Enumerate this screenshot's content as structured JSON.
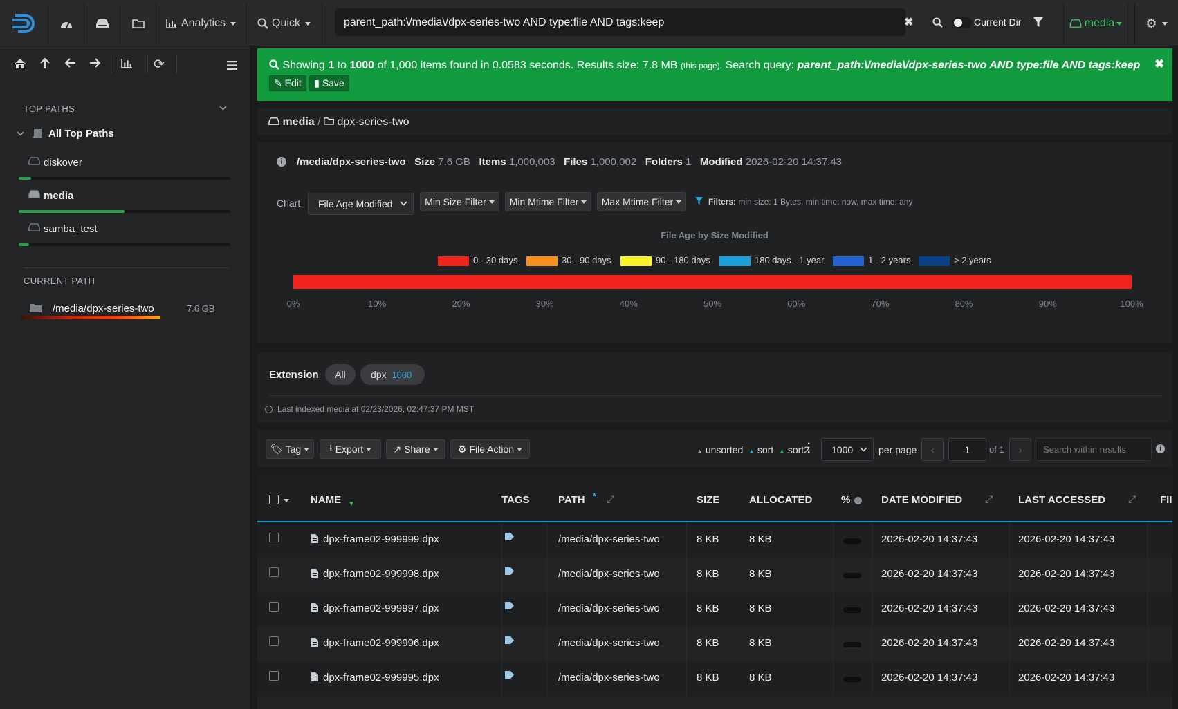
{
  "topbar": {
    "analytics": "Analytics",
    "quick": "Quick",
    "search_value": "parent_path:\\/media\\/dpx-series-two AND type:file AND tags:keep",
    "current_dir": "Current Dir",
    "index": "media"
  },
  "sidebar": {
    "top_paths_header": "TOP PATHS",
    "all_top_paths": "All Top Paths",
    "paths": [
      {
        "name": "diskover",
        "usage": 0.06
      },
      {
        "name": "media",
        "usage": 0.5
      },
      {
        "name": "samba_test",
        "usage": 0.05
      }
    ],
    "current_path_header": "CURRENT PATH",
    "current_path": "/media/dpx-series-two",
    "current_size": "7.6 GB"
  },
  "alert": {
    "showing": "Showing",
    "from": "1",
    "to_word": "to",
    "to": "1000",
    "of_text": "of 1,000 items found in 0.0583 seconds. Results size: 7.8 MB",
    "this_page": "(this page).",
    "query_label": "Search query:",
    "query": "parent_path:\\/media\\/dpx-series-two AND type:file AND tags:keep",
    "edit": "Edit",
    "save": "Save"
  },
  "breadcrumb": {
    "root": "media",
    "sep": "/",
    "folder": "dpx-series-two"
  },
  "info": {
    "path": "/media/dpx-series-two",
    "size_label": "Size",
    "size": "7.6 GB",
    "items_label": "Items",
    "items": "1,000,003",
    "files_label": "Files",
    "files": "1,000,002",
    "folders_label": "Folders",
    "folders": "1",
    "modified_label": "Modified",
    "modified": "2026-02-20 14:37:43"
  },
  "chart_controls": {
    "chart_label": "Chart",
    "chart_select": "File Age Modified",
    "min_size": "Min Size Filter",
    "min_mtime": "Min Mtime Filter",
    "max_mtime": "Max Mtime Filter",
    "filters_label": "Filters:",
    "filters_text": "min size: 1 Bytes, min time: now, max time: any"
  },
  "chart_data": {
    "type": "bar",
    "title": "File Age by Size Modified",
    "orientation": "horizontal-stacked",
    "series": [
      {
        "name": "0 - 30 days",
        "value": 100,
        "color": "#f0241b"
      },
      {
        "name": "30 - 90 days",
        "value": 0,
        "color": "#f7901e"
      },
      {
        "name": "90 - 180 days",
        "value": 0,
        "color": "#f8f328"
      },
      {
        "name": "180 days - 1 year",
        "value": 0,
        "color": "#1a9fd9"
      },
      {
        "name": "1 - 2 years",
        "value": 0,
        "color": "#2262d1"
      },
      {
        "name": "> 2 years",
        "value": 0,
        "color": "#0b4184"
      }
    ],
    "xlim": [
      0,
      100
    ],
    "ticks": [
      "0%",
      "10%",
      "20%",
      "30%",
      "40%",
      "50%",
      "60%",
      "70%",
      "80%",
      "90%",
      "100%"
    ]
  },
  "extension": {
    "label": "Extension",
    "all": "All",
    "ext": "dpx",
    "count": "1000"
  },
  "last_indexed": "Last indexed media at 02/23/2026, 02:47:37 PM MST",
  "toolbar": {
    "tag": "Tag",
    "export": "Export",
    "share": "Share",
    "file_action": "File Action",
    "unsorted": "unsorted",
    "sort": "sort",
    "sort2": "sort2",
    "per_page_value": "1000",
    "per_page": "per page",
    "page": "1",
    "of": "of 1",
    "search_placeholder": "Search within results"
  },
  "table": {
    "headers": {
      "name": "NAME",
      "tags": "TAGS",
      "path": "PATH",
      "size": "SIZE",
      "allocated": "ALLOCATED",
      "pct": "%",
      "modified": "DATE MODIFIED",
      "accessed": "LAST ACCESSED",
      "more": "FII"
    },
    "rows": [
      {
        "name": "dpx-frame02-999999.dpx",
        "path": "/media/dpx-series-two",
        "size": "8 KB",
        "allocated": "8 KB",
        "modified": "2026-02-20 14:37:43",
        "accessed": "2026-02-20 14:37:43"
      },
      {
        "name": "dpx-frame02-999998.dpx",
        "path": "/media/dpx-series-two",
        "size": "8 KB",
        "allocated": "8 KB",
        "modified": "2026-02-20 14:37:43",
        "accessed": "2026-02-20 14:37:43"
      },
      {
        "name": "dpx-frame02-999997.dpx",
        "path": "/media/dpx-series-two",
        "size": "8 KB",
        "allocated": "8 KB",
        "modified": "2026-02-20 14:37:43",
        "accessed": "2026-02-20 14:37:43"
      },
      {
        "name": "dpx-frame02-999996.dpx",
        "path": "/media/dpx-series-two",
        "size": "8 KB",
        "allocated": "8 KB",
        "modified": "2026-02-20 14:37:43",
        "accessed": "2026-02-20 14:37:43"
      },
      {
        "name": "dpx-frame02-999995.dpx",
        "path": "/media/dpx-series-two",
        "size": "8 KB",
        "allocated": "8 KB",
        "modified": "2026-02-20 14:37:43",
        "accessed": "2026-02-20 14:37:43"
      }
    ]
  }
}
